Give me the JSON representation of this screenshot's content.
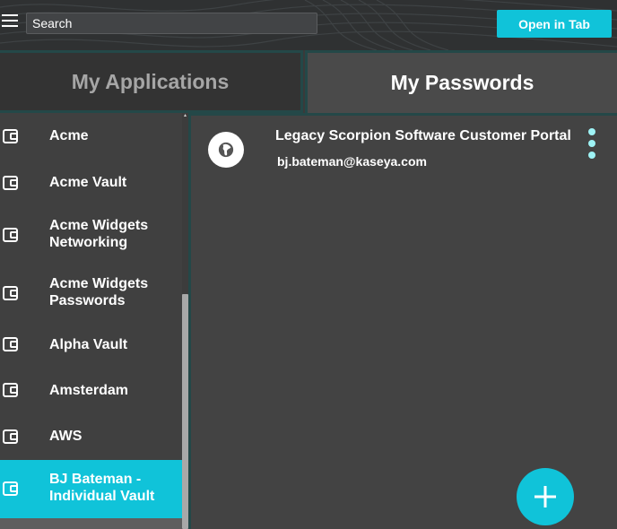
{
  "header": {
    "search_placeholder": "Search",
    "open_tab_label": "Open in Tab"
  },
  "tabs": [
    {
      "label": "My Applications",
      "active": false
    },
    {
      "label": "My Passwords",
      "active": true
    }
  ],
  "sidebar": {
    "items": [
      {
        "label": "Acme",
        "icon": "vault-icon"
      },
      {
        "label": "Acme Vault",
        "icon": "vault-icon"
      },
      {
        "label": "Acme Widgets Networking",
        "icon": "vault-icon"
      },
      {
        "label": "Acme Widgets Passwords",
        "icon": "vault-icon"
      },
      {
        "label": "Alpha Vault",
        "icon": "vault-icon"
      },
      {
        "label": "Amsterdam",
        "icon": "vault-icon"
      },
      {
        "label": "AWS",
        "icon": "vault-icon"
      },
      {
        "label": "BJ Bateman - Individual Vault",
        "icon": "vault-icon",
        "selected": true
      }
    ]
  },
  "passwords": [
    {
      "title": "Legacy Scorpion Software Customer Portal",
      "username": "bj.bateman@kaseya.com",
      "icon": "globe-icon"
    }
  ],
  "colors": {
    "accent": "#10c3d9",
    "kebab": "#9ef3f5",
    "border": "#244848"
  }
}
